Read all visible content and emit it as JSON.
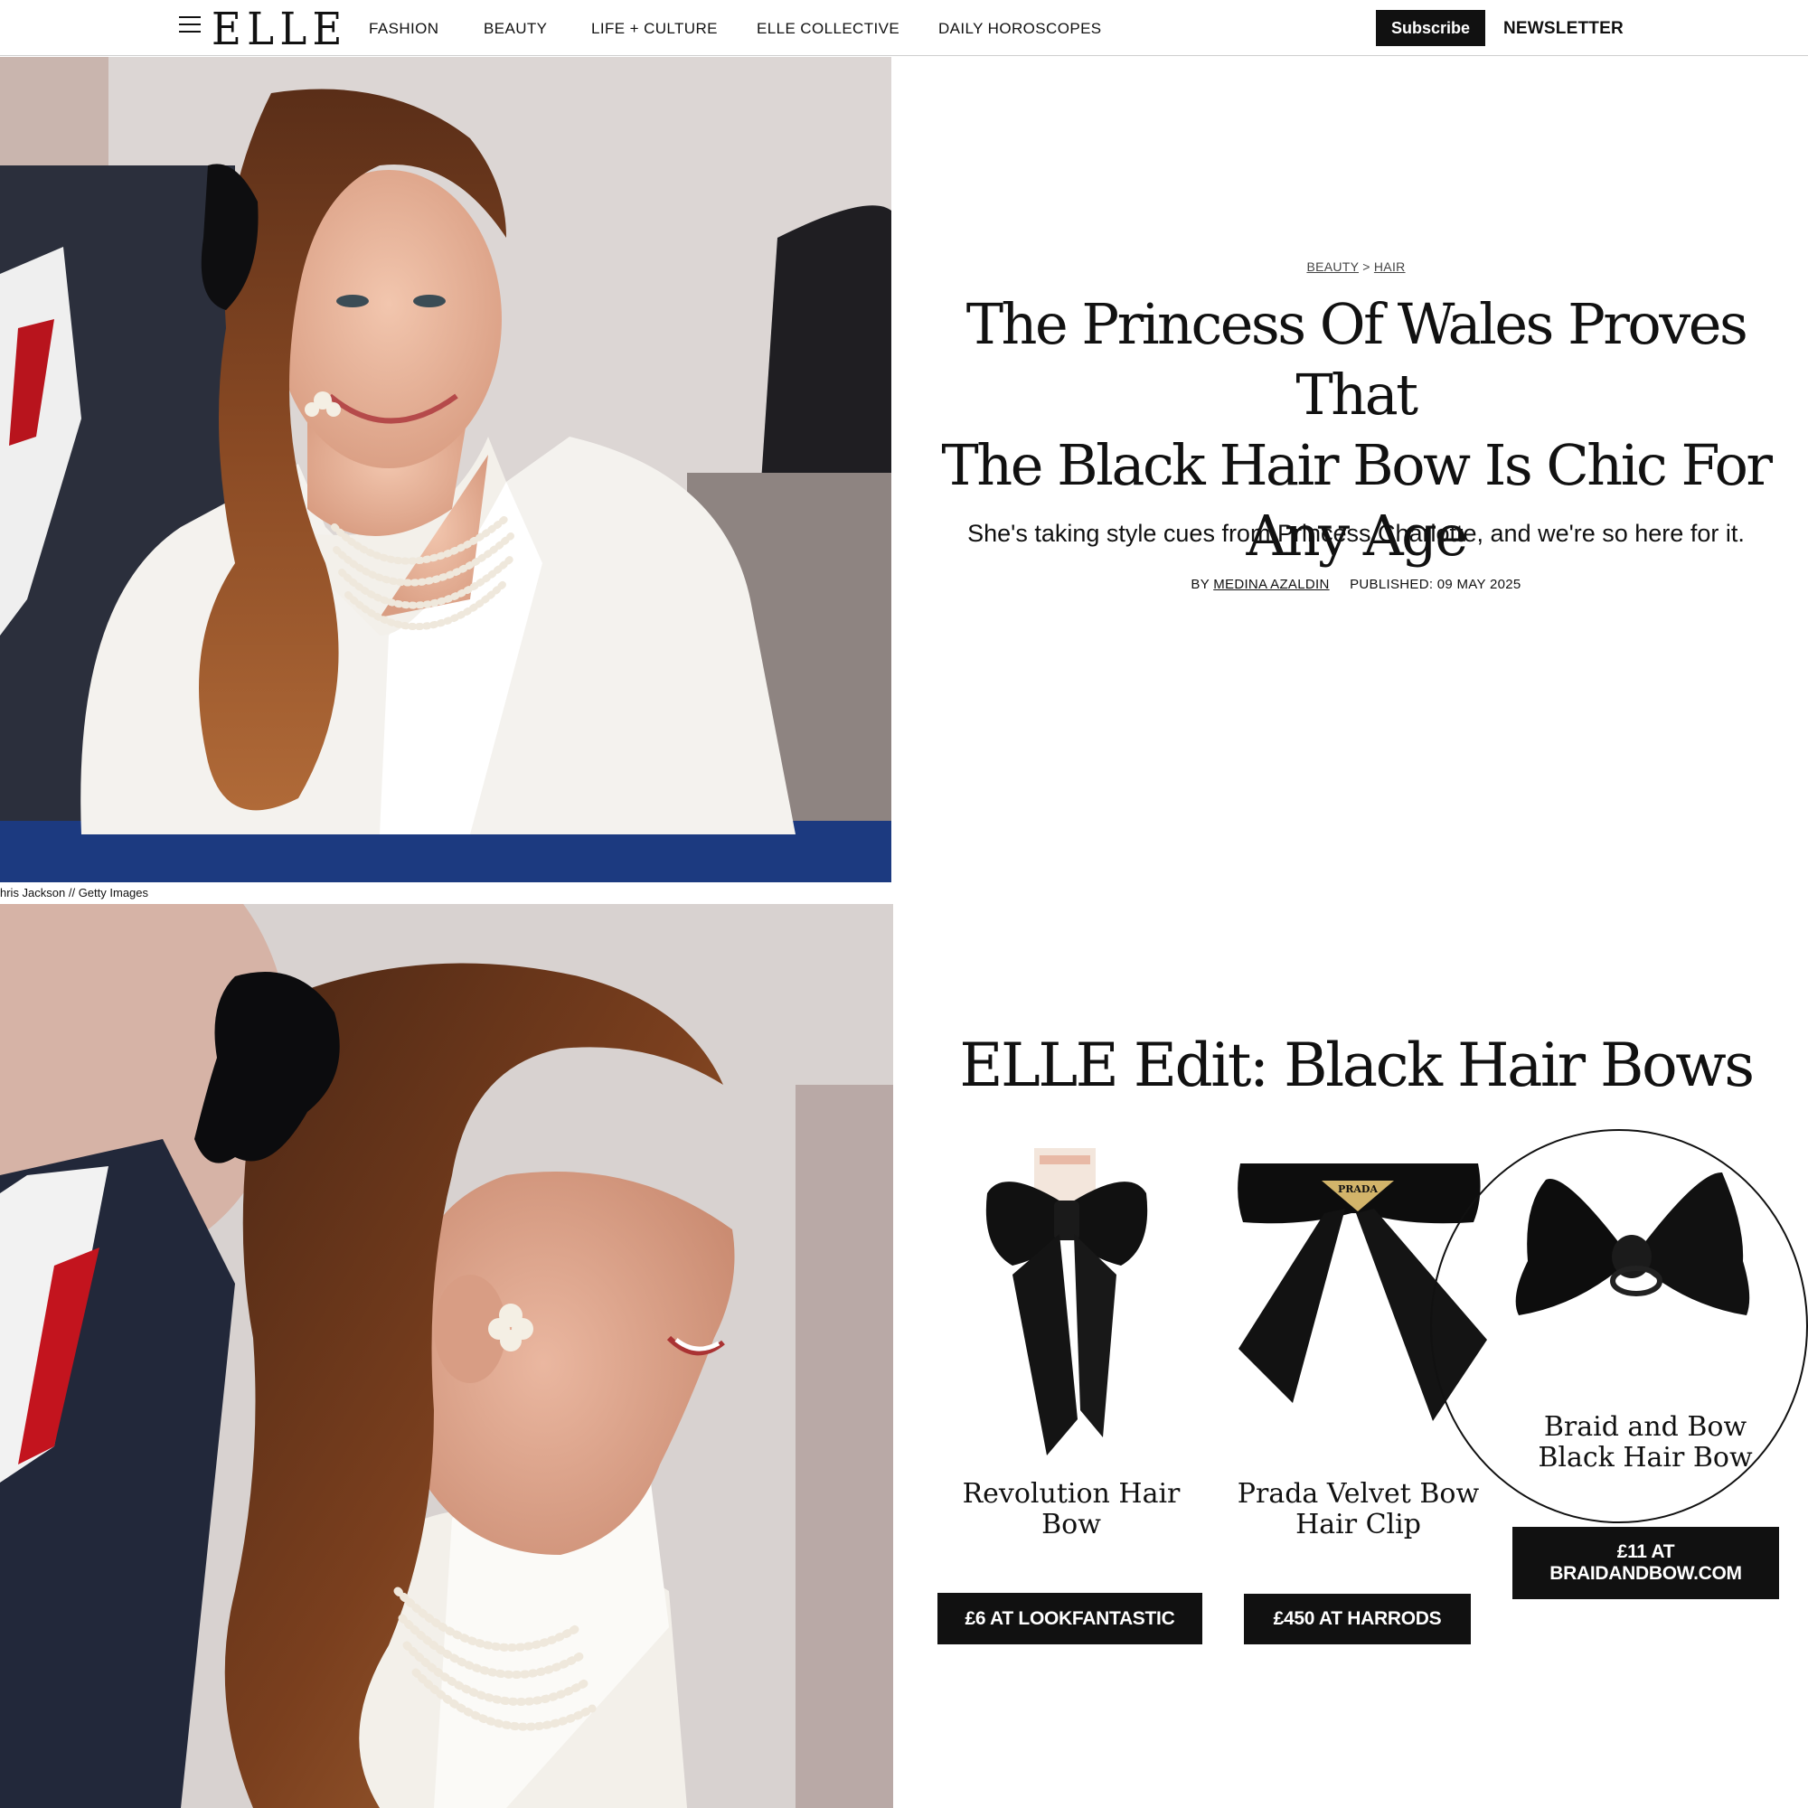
{
  "header": {
    "logo": "ELLE",
    "nav": [
      "FASHION",
      "BEAUTY",
      "LIFE + CULTURE",
      "ELLE COLLECTIVE",
      "DAILY HOROSCOPES"
    ],
    "subscribe_label": "Subscribe",
    "newsletter_label": "NEWSLETTER"
  },
  "photo_credit": "hris Jackson  //  Getty Images",
  "article": {
    "breadcrumb": [
      "BEAUTY",
      "HAIR"
    ],
    "breadcrumb_sep": ">",
    "headline_lines": [
      "The Princess Of Wales Proves That",
      "The Black Hair Bow Is Chic For",
      "Any Age"
    ],
    "standfirst": "She's taking style cues from Princess Charlotte, and we're so here for it.",
    "byline_prefix": "BY",
    "author": "MEDINA AZALDIN",
    "published": "PUBLISHED: 09 MAY 2025"
  },
  "edit": {
    "title": "ELLE Edit: Black Hair Bows",
    "products": [
      {
        "name_lines": [
          "Revolution Hair",
          "Bow"
        ],
        "cta": "£6 AT LOOKFANTASTIC"
      },
      {
        "name_lines": [
          "Prada Velvet Bow",
          "Hair Clip"
        ],
        "cta": "£450 AT HARRODS",
        "logo_text": "PRADA"
      },
      {
        "name_lines": [
          "Braid and Bow",
          "Black Hair Bow"
        ],
        "cta_lines": [
          "£11 AT",
          "BRAIDANDBOW.COM"
        ]
      }
    ]
  }
}
